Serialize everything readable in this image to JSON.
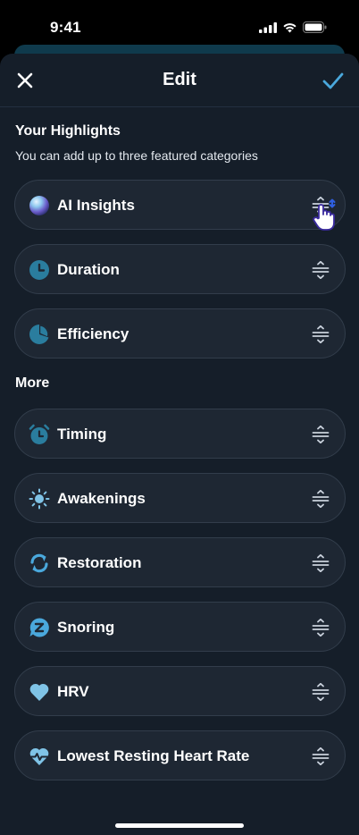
{
  "status_bar": {
    "time": "9:41"
  },
  "header": {
    "title": "Edit"
  },
  "highlights": {
    "title": "Your Highlights",
    "subtitle": "You can add up to three featured categories",
    "items": [
      {
        "label": "AI Insights",
        "icon": "ai-orb-icon"
      },
      {
        "label": "Duration",
        "icon": "clock-icon"
      },
      {
        "label": "Efficiency",
        "icon": "pie-chart-icon"
      }
    ]
  },
  "more": {
    "title": "More",
    "items": [
      {
        "label": "Timing",
        "icon": "alarm-clock-icon"
      },
      {
        "label": "Awakenings",
        "icon": "sun-icon"
      },
      {
        "label": "Restoration",
        "icon": "refresh-icon"
      },
      {
        "label": "Snoring",
        "icon": "snore-bubble-icon"
      },
      {
        "label": "HRV",
        "icon": "heart-icon"
      },
      {
        "label": "Lowest Resting Heart Rate",
        "icon": "heart-pulse-icon"
      }
    ]
  },
  "colors": {
    "background": "#151e29",
    "row_background": "#1e2733",
    "accent_blue": "#4aa8dc",
    "icon_teal": "#2a7d9e",
    "icon_light": "#7fc3e6"
  }
}
